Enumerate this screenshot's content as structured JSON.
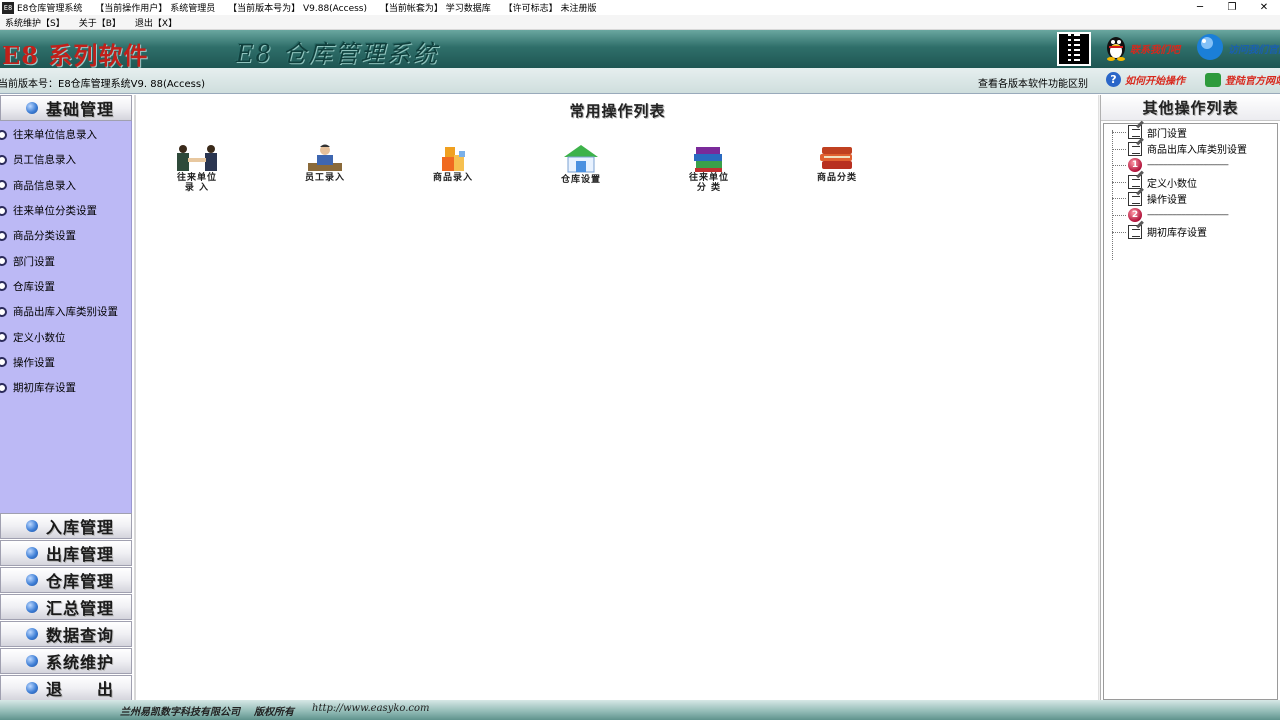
{
  "titlebar": {
    "app_icon": "E8",
    "app_name": "E8仓库管理系统",
    "current_user_label": "【当前操作用户】",
    "current_user": "系统管理员",
    "version_label": "【当前版本号为】",
    "version": "V9.88(Access)",
    "account_label": "【当前帐套为】",
    "account": "学习数据库",
    "license_label": "【许可标志】",
    "license": "未注册版",
    "buttons": {
      "minimize": "─",
      "restore": "❐",
      "close": "✕"
    }
  },
  "menubar": {
    "items": [
      "系统维护【S】",
      "关于【B】",
      "退出【X】"
    ]
  },
  "banner": {
    "brand": "E8 系列软件",
    "system_name": "E8 仓库管理系统",
    "qq_text": "联系我们吧",
    "globe_text": "访问我们官网"
  },
  "verstrip": {
    "version_text": "当前版本号：E8仓库管理系统V9. 88(Access)",
    "compare_link": "查看各版本软件功能区别",
    "howto_text": "如何开始操作",
    "official_text": "登陆官方网站"
  },
  "left": {
    "active_section": "基础管理",
    "items": [
      "往来单位信息录入",
      "员工信息录入",
      "商品信息录入",
      "往来单位分类设置",
      "商品分类设置",
      "部门设置",
      "仓库设置",
      "商品出库入库类别设置",
      "定义小数位",
      "操作设置",
      "期初库存设置"
    ],
    "sections": [
      "入库管理",
      "出库管理",
      "仓库管理",
      "汇总管理",
      "数据查询",
      "系统维护",
      "退　　出"
    ]
  },
  "center": {
    "title": "常用操作列表",
    "quick_items": [
      {
        "line1": "往来单位",
        "line2": "录 入",
        "icon": "handshake-icon"
      },
      {
        "line1": "员工录入",
        "line2": "",
        "icon": "employee-icon"
      },
      {
        "line1": "商品录入",
        "line2": "",
        "icon": "goods-icon"
      },
      {
        "line1": "仓库设置",
        "line2": "",
        "icon": "warehouse-icon"
      },
      {
        "line1": "往来单位",
        "line2": "分 类",
        "icon": "books-stack-icon"
      },
      {
        "line1": "商品分类",
        "line2": "",
        "icon": "books-icon"
      }
    ]
  },
  "right": {
    "title": "其他操作列表",
    "nodes": [
      {
        "type": "memo",
        "label": "部门设置"
      },
      {
        "type": "memo",
        "label": "商品出库入库类别设置"
      },
      {
        "type": "num",
        "num": "1",
        "label": "------------------------------------"
      },
      {
        "type": "memo",
        "label": "定义小数位"
      },
      {
        "type": "memo",
        "label": "操作设置"
      },
      {
        "type": "num",
        "num": "2",
        "label": "------------------------------------"
      },
      {
        "type": "memo",
        "label": "期初库存设置"
      }
    ]
  },
  "statusbar": {
    "company": "兰州易凯数字科技有限公司",
    "rights": "版权所有",
    "url": "http://www.easyko.com"
  },
  "colors": {
    "banner_teal": "#2f6f6a",
    "brand_red": "#c0201a",
    "left_item_bg": "#bcb9f5",
    "link_red": "#d8281c"
  }
}
